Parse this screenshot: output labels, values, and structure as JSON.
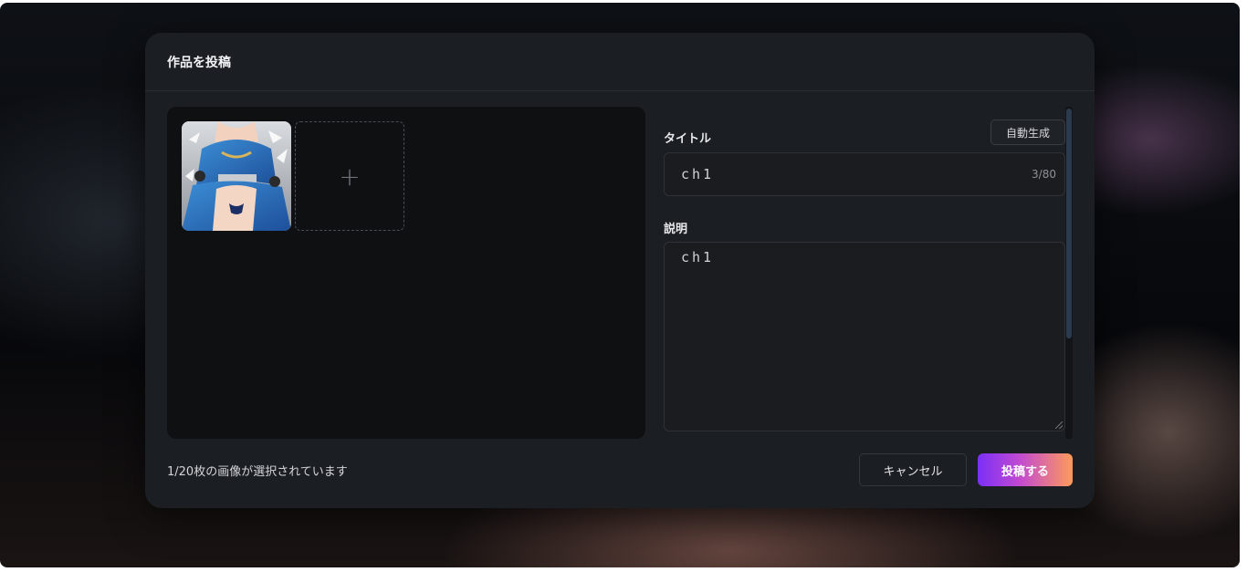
{
  "modal": {
    "title": "作品を投稿"
  },
  "images": {
    "thumbnail_icon": "artwork-image",
    "add_icon": "plus-icon",
    "add_symbol": "+"
  },
  "form": {
    "title_label": "タイトル",
    "auto_generate_label": "自動生成",
    "title_value": "ch1",
    "title_counter": "3/80",
    "description_label": "説明",
    "description_value": "ch1"
  },
  "footer": {
    "status": "1/20枚の画像が選択されています",
    "cancel_label": "キャンセル",
    "submit_label": "投稿する"
  },
  "colors": {
    "modal_bg": "#1b1e22",
    "image_area_bg": "#0f1012",
    "submit_gradient_start": "#7b2ff7",
    "submit_gradient_end": "#ff9a5a",
    "scroll_thumb": "#2b3a4c"
  }
}
